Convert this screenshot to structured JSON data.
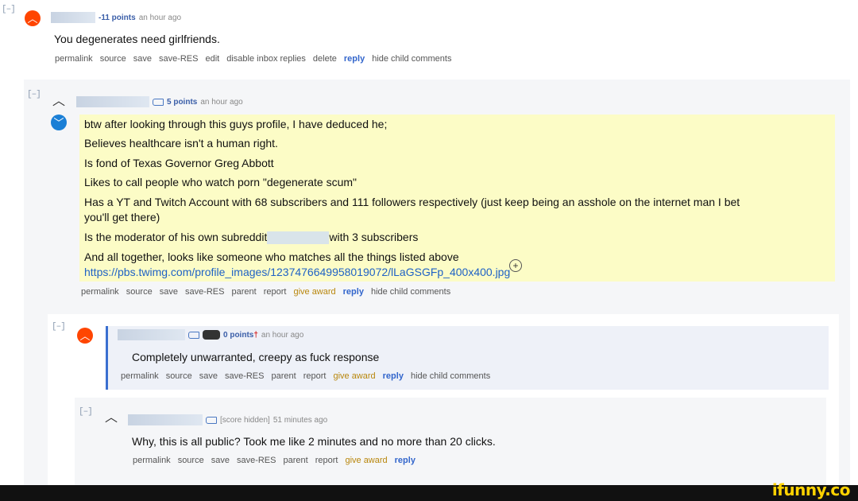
{
  "collapse_label": "[–]",
  "comment1": {
    "score": "-11 points",
    "time": "an hour ago",
    "body": "You degenerates need girlfriends.",
    "actions": [
      "permalink",
      "source",
      "save",
      "save-RES",
      "edit",
      "disable inbox replies",
      "delete",
      "reply",
      "hide child comments"
    ]
  },
  "comment2": {
    "score": "5 points",
    "time": "an hour ago",
    "lines": [
      "btw after looking through this guys profile, I have deduced he;",
      "Believes healthcare isn't a human right.",
      "Is fond of Texas Governor Greg Abbott",
      "Likes to call people who watch porn \"degenerate scum\"",
      "Has a YT and Twitch Account with 68 subscribers and 111 followers respectively (just keep being an asshole on the internet man I bet",
      "you'll get there)"
    ],
    "mod_prefix": "Is the moderator of his own subreddit",
    "mod_suffix": "with 3 subscribers",
    "last_line": "And all together, looks like someone who matches all the things listed above",
    "link": "https://pbs.twimg.com/profile_images/1237476649958019072/lLaGSGFp_400x400.jpg",
    "actions": [
      "permalink",
      "source",
      "save",
      "save-RES",
      "parent",
      "report",
      "give award",
      "reply",
      "hide child comments"
    ]
  },
  "comment3": {
    "score": "0 points",
    "score_mark": "†",
    "time": "an hour ago",
    "body": "Completely unwarranted, creepy as fuck response",
    "actions": [
      "permalink",
      "source",
      "save",
      "save-RES",
      "parent",
      "report",
      "give award",
      "reply",
      "hide child comments"
    ]
  },
  "comment4": {
    "score": "[score hidden]",
    "time": "51 minutes ago",
    "body": "Why, this is all public? Took me like 2 minutes and no more than 20 clicks.",
    "actions": [
      "permalink",
      "source",
      "save",
      "save-RES",
      "parent",
      "report",
      "give award",
      "reply"
    ]
  },
  "watermark": "ifunny.co",
  "colors": {
    "upvote": "#ff4500",
    "vote_blue": "#1a7fd6",
    "reply": "#3366cc",
    "award": "#b8860b",
    "highlight": "#fcfcc6"
  }
}
